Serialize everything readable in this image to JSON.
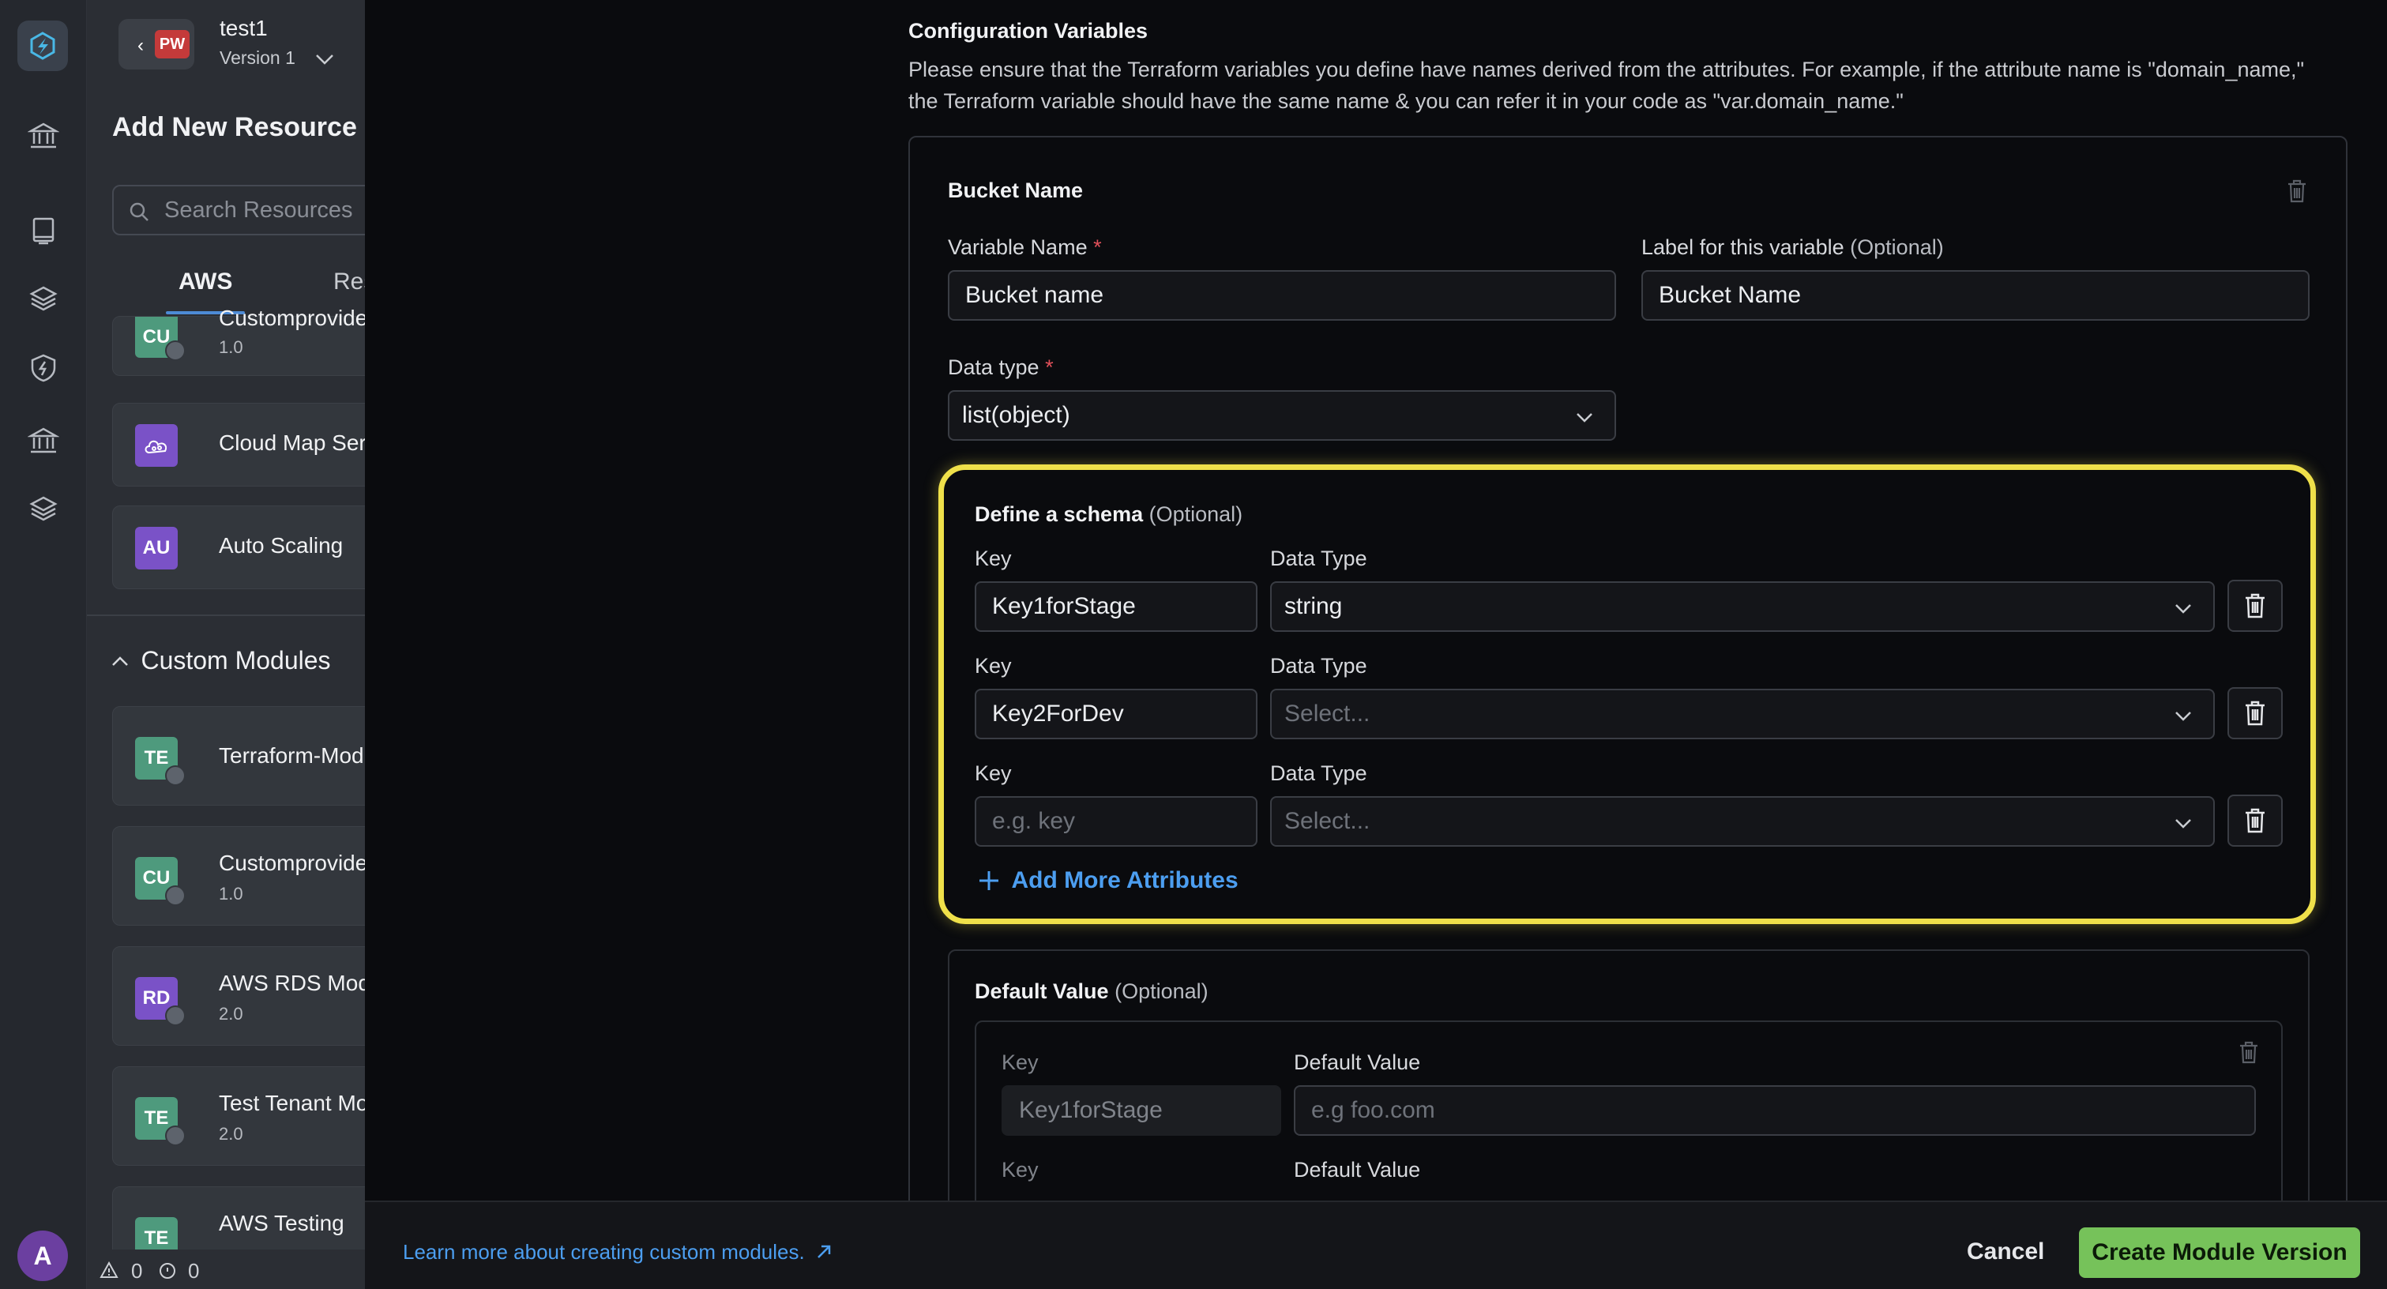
{
  "project": {
    "initials": "PW",
    "name": "test1",
    "version": "Version 1"
  },
  "user": {
    "avatar_initial": "A"
  },
  "panel": {
    "title": "Add New Resource",
    "search_placeholder": "Search Resources",
    "tabs": [
      "AWS",
      "Res"
    ],
    "top_cards": [
      {
        "initials": "CU",
        "name": "Customprovider",
        "version": "1.0",
        "color": "#4e9a7d"
      },
      {
        "initials": "",
        "name": "Cloud Map Servic",
        "version": "",
        "color": "#7a52c7"
      },
      {
        "initials": "AU",
        "name": "Auto Scaling",
        "version": "",
        "color": "#7a52c7"
      }
    ],
    "custom_modules_title": "Custom Modules",
    "custom_cards": [
      {
        "initials": "TE",
        "name": "Terraform-Modu",
        "version": "",
        "color": "#4e9a7d"
      },
      {
        "initials": "CU",
        "name": "Customprovider",
        "version": "1.0",
        "color": "#4e9a7d"
      },
      {
        "initials": "RD",
        "name": "AWS RDS Module",
        "version": "2.0",
        "color": "#7a52c7"
      },
      {
        "initials": "TE",
        "name": "Test Tenant Modu",
        "version": "2.0",
        "color": "#4e9a7d"
      },
      {
        "initials": "TE",
        "name": "AWS Testing",
        "version": "",
        "color": "#4e9a7d"
      }
    ],
    "status": {
      "warnings": "0",
      "info": "0"
    }
  },
  "config": {
    "title": "Configuration Variables",
    "help_line1": "Please ensure that the Terraform variables you define have names derived from the attributes. For example, if the attribute name is \"domain_name,\"",
    "help_line2": "the Terraform variable should have the same name & you can refer it in your code as \"var.domain_name.\"",
    "variable": {
      "heading": "Bucket Name",
      "name_label": "Variable Name",
      "name_value": "Bucket name",
      "label_label": "Label for this variable",
      "optional_text": "(Optional)",
      "label_value": "Bucket Name",
      "type_label": "Data type",
      "type_value": "list(object)"
    },
    "schema": {
      "title": "Define a schema",
      "optional_text": "(Optional)",
      "key_label": "Key",
      "type_label": "Data Type",
      "key_placeholder": "e.g. key",
      "type_placeholder": "Select...",
      "rows": [
        {
          "key": "Key1forStage",
          "type": "string"
        },
        {
          "key": "Key2ForDev",
          "type": ""
        },
        {
          "key": "",
          "type": ""
        }
      ],
      "add_more": "Add More Attributes"
    },
    "default_value": {
      "title": "Default Value",
      "optional_text": "(Optional)",
      "key_label": "Key",
      "value_label": "Default Value",
      "row1_key": "Key1forStage",
      "row1_placeholder": "e.g foo.com"
    }
  },
  "footer": {
    "learn_more": "Learn more about creating custom modules.",
    "cancel": "Cancel",
    "create": "Create Module Version"
  },
  "colors": {
    "highlight": "#efe04a",
    "primary_button": "#76c25a",
    "link": "#4c9ef0"
  }
}
